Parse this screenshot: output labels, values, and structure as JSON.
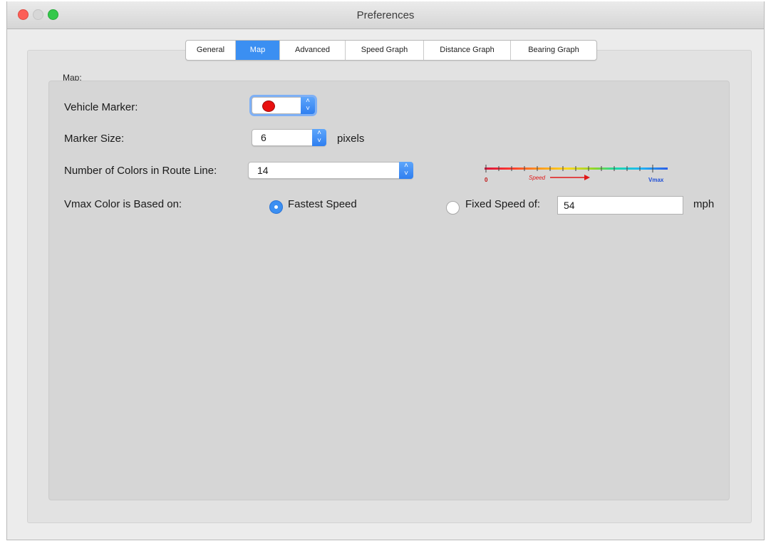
{
  "window": {
    "title": "Preferences"
  },
  "tabs": [
    {
      "label": "General",
      "active": false
    },
    {
      "label": "Map",
      "active": true
    },
    {
      "label": "Advanced",
      "active": false
    },
    {
      "label": "Speed Graph",
      "active": false
    },
    {
      "label": "Distance Graph",
      "active": false
    },
    {
      "label": "Bearing Graph",
      "active": false
    }
  ],
  "map": {
    "group_label": "Map:",
    "vehicle_marker": {
      "label": "Vehicle Marker:",
      "selected": "red-circle",
      "color": "#e8100f"
    },
    "marker_size": {
      "label": "Marker Size:",
      "value": "6",
      "unit": "pixels"
    },
    "route_colors": {
      "label": "Number of Colors in Route Line:",
      "value": "14"
    },
    "scale_legend": {
      "start_label": "0",
      "speed_label": "Speed",
      "end_label": "Vmax"
    },
    "vmax": {
      "label": "Vmax Color is Based on:",
      "option_fastest": "Fastest Speed",
      "option_fixed": "Fixed Speed of:",
      "selected": "fastest",
      "fixed_value": "54",
      "unit": "mph"
    }
  },
  "colors": {
    "accent": "#3b8ff2"
  }
}
